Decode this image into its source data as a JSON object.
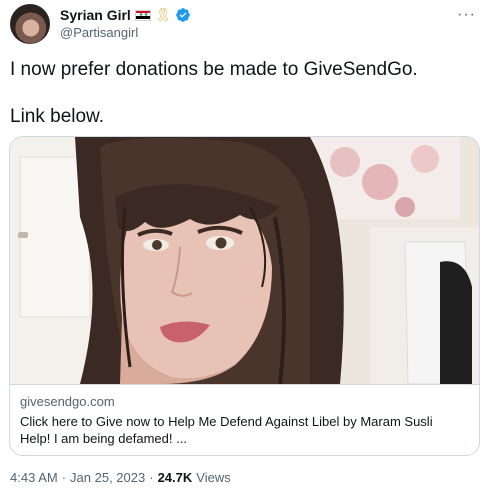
{
  "author": {
    "display_name": "Syrian Girl",
    "handle": "@Partisangirl",
    "badges": [
      "syria-flag-icon",
      "ribbon-icon",
      "verified-badge-icon"
    ],
    "verified_color": "#1d9bf0"
  },
  "more_icon": "more-dots-icon",
  "tweet": {
    "line1": "I now prefer donations be made to GiveSendGo.",
    "line2": "Link below."
  },
  "link_card": {
    "domain": "givesendgo.com",
    "title": "Click here to Give now to Help Me Defend Against Libel by Maram Susli",
    "description": "Help! I am being defamed! ..."
  },
  "meta": {
    "time": "4:43 AM",
    "separator": "·",
    "date": "Jan 25, 2023",
    "views_count": "24.7K",
    "views_label": "Views"
  }
}
